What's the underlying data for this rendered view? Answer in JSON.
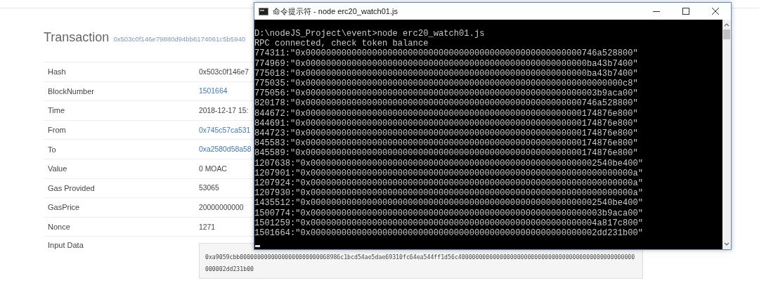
{
  "page": {
    "title": "Transaction",
    "hash": "0x503c0f146e79880d94bb6174061c5b5940",
    "rows": [
      {
        "label": "Hash",
        "value": "0x503c0f146e7",
        "kind": "text"
      },
      {
        "label": "BlockNumber",
        "value": "1501664",
        "kind": "link"
      },
      {
        "label": "Time",
        "value": "2018-12-17 15:",
        "kind": "text"
      },
      {
        "label": "From",
        "value": "0x745c57ca531",
        "kind": "link"
      },
      {
        "label": "To",
        "value": "0xa2580d58a58",
        "kind": "link"
      },
      {
        "label": "Value",
        "value": "0 MOAC",
        "kind": "text"
      },
      {
        "label": "Gas Provided",
        "value": "53065",
        "kind": "text"
      },
      {
        "label": "GasPrice",
        "value": "20000000000",
        "kind": "text"
      },
      {
        "label": "Nonce",
        "value": "1271",
        "kind": "text"
      },
      {
        "label": "Input Data",
        "value": "0xa9059cbb00000000000000000000000068986c1bcd54ae5dae69310fc64ea544ff1d56c400000000000000000000000000000000000000000000000000000002dd231b00",
        "kind": "code"
      }
    ]
  },
  "console": {
    "title": "命令提示符 - node  erc20_watch01.js",
    "lines": [
      "D:\\nodeJS_Project\\event>node erc20_watch01.js",
      "RPC connected, check token balance",
      "774311:\"0x000000000000000000000000000000000000000000000000000000746a528800\"",
      "774969:\"0x0000000000000000000000000000000000000000000000000000000ba43b7400\"",
      "775018:\"0x0000000000000000000000000000000000000000000000000000000ba43b7400\"",
      "775035:\"0x00000000000000000000000000000000000000000000000000000000000000c8\"",
      "775056:\"0x000000000000000000000000000000000000000000000000000000003b9aca00\"",
      "820178:\"0x000000000000000000000000000000000000000000000000000000746a528800\"",
      "844672:\"0x000000000000000000000000000000000000000000000000000000174876e800\"",
      "844691:\"0x000000000000000000000000000000000000000000000000000000174876e800\"",
      "844723:\"0x000000000000000000000000000000000000000000000000000000174876e800\"",
      "845583:\"0x000000000000000000000000000000000000000000000000000000174876e800\"",
      "845589:\"0x000000000000000000000000000000000000000000000000000000174876e800\"",
      "1207638:\"0x00000000000000000000000000000000000000000000000000000002540be400\"",
      "1207901:\"0x000000000000000000000000000000000000000000000000000000000000000a\"",
      "1207924:\"0x000000000000000000000000000000000000000000000000000000000000000a\"",
      "1207930:\"0x000000000000000000000000000000000000000000000000000000000000000a\"",
      "1435512:\"0x00000000000000000000000000000000000000000000000000000002540be400\"",
      "1500774:\"0x000000000000000000000000000000000000000000000000000000003b9aca00\"",
      "1501259:\"0x00000000000000000000000000000000000000000000000000000004a817c800\"",
      "1501664:\"0x00000000000000000000000000000000000000000000000000000002dd231b00\""
    ]
  }
}
